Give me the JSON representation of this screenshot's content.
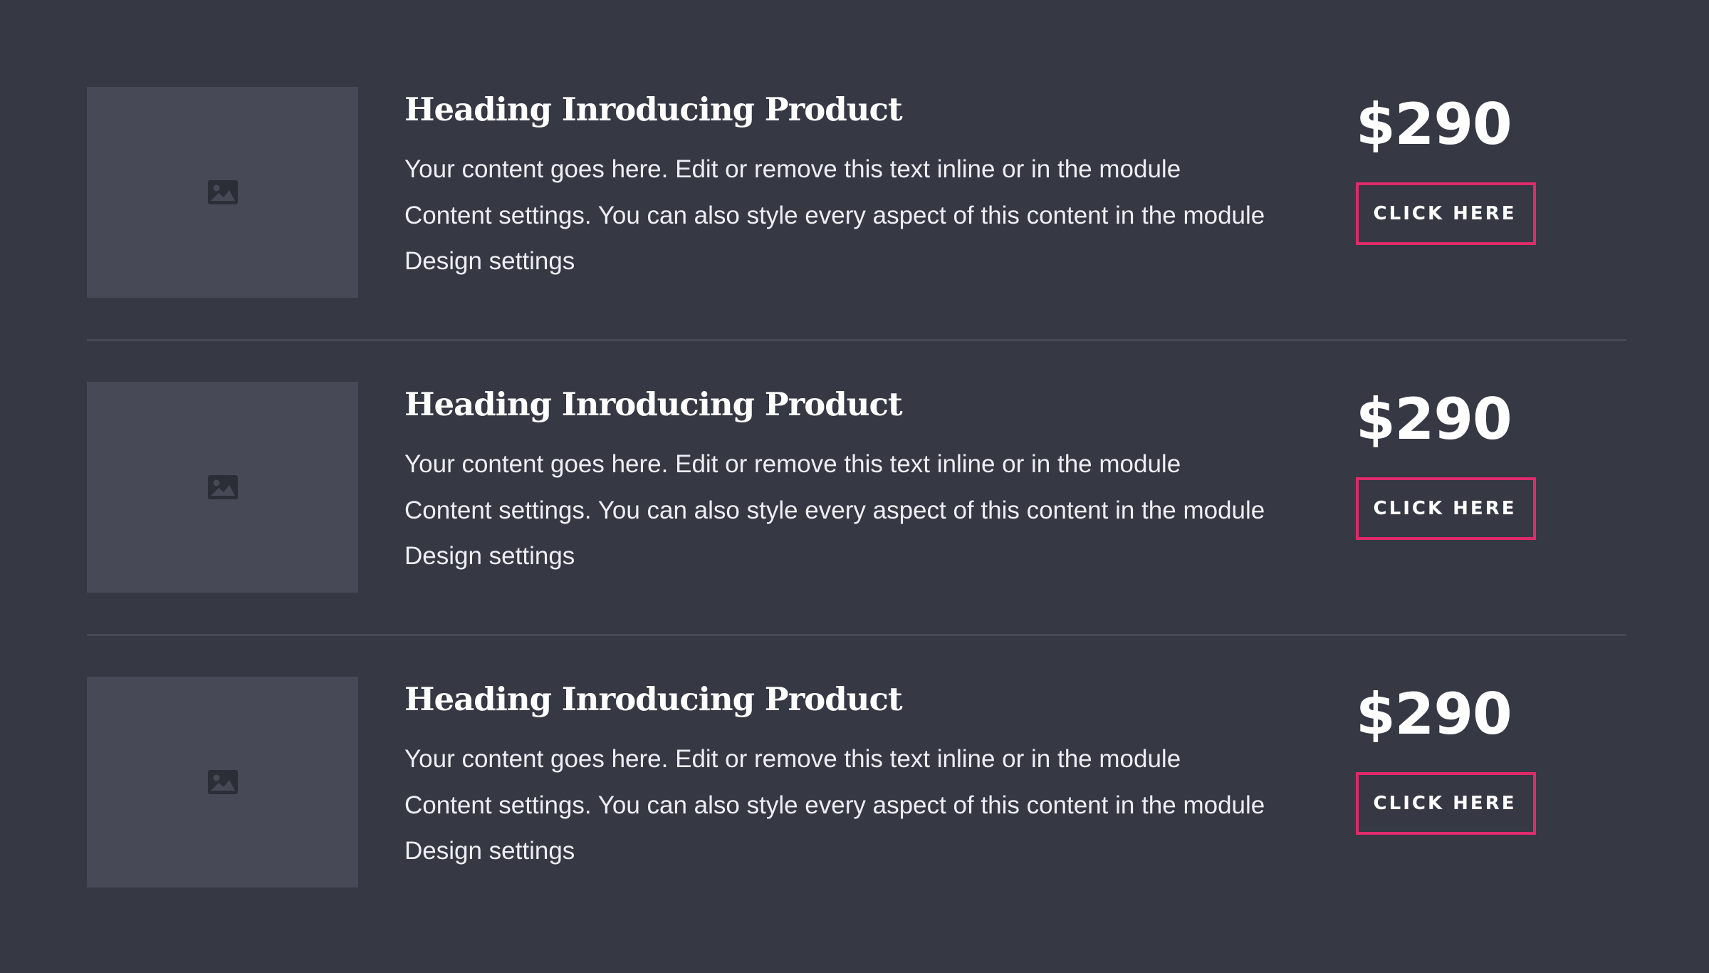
{
  "colors": {
    "background": "#363844",
    "placeholder": "#474957",
    "placeholder_icon": "#2c2e37",
    "divider": "#464955",
    "accent": "#e02b6b",
    "text": "#ffffff"
  },
  "products": [
    {
      "image_icon": "image-placeholder-icon",
      "title": "Heading Inroducing Product",
      "desc_lines": [
        "Your content goes here. Edit or remove this text inline or in the module",
        "Content settings. You can also style every aspect of this content in the module",
        "Design settings"
      ],
      "price": "$290",
      "button_label": "CLICK HERE"
    },
    {
      "image_icon": "image-placeholder-icon",
      "title": "Heading Inroducing Product",
      "desc_lines": [
        "Your content goes here. Edit or remove this text inline or in the module",
        "Content settings. You can also style every aspect of this content in the module",
        "Design settings"
      ],
      "price": "$290",
      "button_label": "CLICK HERE"
    },
    {
      "image_icon": "image-placeholder-icon",
      "title": "Heading Inroducing Product",
      "desc_lines": [
        "Your content goes here. Edit or remove this text inline or in the module",
        "Content settings. You can also style every aspect of this content in the module",
        "Design settings"
      ],
      "price": "$290",
      "button_label": "CLICK HERE"
    }
  ]
}
